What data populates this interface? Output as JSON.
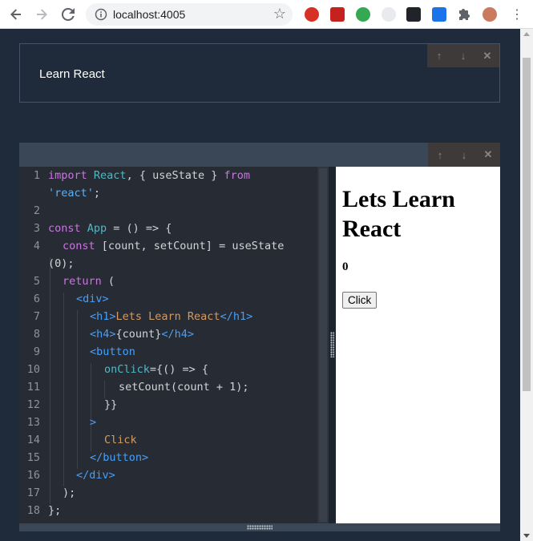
{
  "browser": {
    "url": "localhost:4005",
    "icons": [
      "back-arrow",
      "forward-arrow",
      "reload",
      "info",
      "star",
      "extensions"
    ]
  },
  "text_cell": {
    "label": "Learn React",
    "tools": [
      "↑",
      "↓",
      "✕"
    ]
  },
  "code_cell": {
    "tools": [
      "↑",
      "↓",
      "✕"
    ],
    "line_numbers": [
      "1",
      "2",
      "3",
      "4",
      "5",
      "6",
      "7",
      "8",
      "9",
      "10",
      "11",
      "12",
      "13",
      "14",
      "15",
      "16",
      "17",
      "18"
    ],
    "code": {
      "l1a": "import",
      "l1b": " React",
      "l1c": ", { ",
      "l1d": "useState",
      "l1e": " } ",
      "l1f": "from",
      "l1w": "'react'",
      "l1x": ";",
      "l3a": "const",
      "l3b": " App",
      "l3c": " = () => {",
      "l4a": "const",
      "l4b": " [count, setCount] = useState",
      "l4w": "(0);",
      "l5a": "return",
      "l5b": " (",
      "l6a": "<div>",
      "l7a": "<h1>",
      "l7b": "Lets Learn React",
      "l7c": "</h1>",
      "l8a": "<h4>",
      "l8b": "{count}",
      "l8c": "</h4>",
      "l9a": "<button",
      "l10a": "onClick",
      "l10b": "={() => {",
      "l11a": "setCount(count + 1);",
      "l12a": "}}",
      "l13a": ">",
      "l14a": "Click",
      "l15a": "</button>",
      "l16a": "</div>",
      "l17a": ");",
      "l18a": "};"
    }
  },
  "preview": {
    "heading": "Lets Learn React",
    "count": "0",
    "button_label": "Click"
  },
  "colors": {
    "page_bg": "#1f2b3a",
    "editor_bg": "#272b33",
    "keyword": "#c678dd",
    "identifier": "#56b6c2",
    "tag": "#4a9ff5",
    "string_text": "#d19a66"
  }
}
